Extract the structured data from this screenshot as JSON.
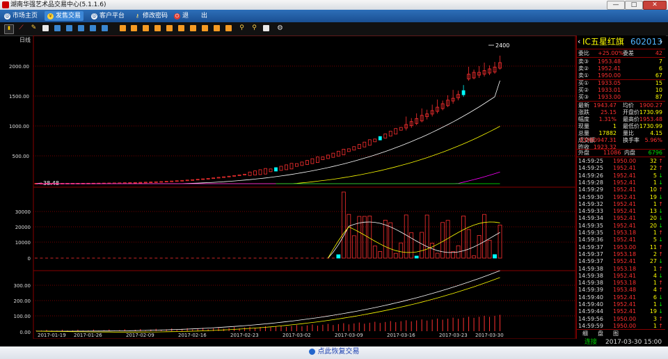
{
  "window": {
    "title": "湖南华强艺术品交易中心(5.1.1.6)",
    "minimize": "—",
    "maximize": "□",
    "close": "✕"
  },
  "menu": [
    {
      "label": "市场主页",
      "icon": "globe-icon"
    },
    {
      "label": "发售交易",
      "icon": "yen-icon"
    },
    {
      "label": "客户平台",
      "icon": "globe-icon"
    },
    {
      "label": "修改密码",
      "icon": "key-icon"
    },
    {
      "label": "退　　出",
      "icon": "power-icon"
    }
  ],
  "chart": {
    "period_label": "日线",
    "price_ticks": [
      "2000.00",
      "1500.00",
      "1000.00",
      "500.00"
    ],
    "low_marker": "38.48",
    "high_marker": "2400",
    "volume_ticks": [
      "30000",
      "20000",
      "10000",
      "0"
    ],
    "amount_ticks": [
      "300.00",
      "200.00",
      "100.00",
      "0.00"
    ],
    "dates": [
      "2017-01-19",
      "2017-01-26",
      "2017-02-09",
      "2017-02-16",
      "2017-02-23",
      "2017-03-02",
      "2017-03-09",
      "2017-03-16",
      "2017-03-23",
      "2017-03-30"
    ]
  },
  "quote": {
    "name": "IC五星红旗",
    "code": "602013",
    "weibi_label": "委比",
    "weibi_value": "+25.00%",
    "weicha_label": "委差",
    "weicha_value": "42",
    "sell": [
      {
        "label": "卖③",
        "price": "1953.48",
        "vol": "7"
      },
      {
        "label": "卖②",
        "price": "1952.41",
        "vol": "6"
      },
      {
        "label": "卖①",
        "price": "1950.00",
        "vol": "67"
      }
    ],
    "buy": [
      {
        "label": "买①",
        "price": "1933.05",
        "vol": "15"
      },
      {
        "label": "买②",
        "price": "1933.01",
        "vol": "10"
      },
      {
        "label": "买③",
        "price": "1933.00",
        "vol": "87"
      }
    ],
    "stats": [
      {
        "l1": "最新",
        "v1": "1943.47",
        "l2": "均价",
        "v2": "1900.27"
      },
      {
        "l1": "涨跌",
        "v1": "25.15",
        "l2": "开盘价",
        "v2": "1730.99"
      },
      {
        "l1": "幅度",
        "v1": "1.31%",
        "l2": "最高价",
        "v2": "1953.48"
      },
      {
        "l1": "现量",
        "v1": "1",
        "l2": "最低价",
        "v2": "1730.99"
      },
      {
        "l1": "总量",
        "v1": "17882",
        "l2": "量比",
        "v2": "4.15"
      },
      {
        "l1": "成交额",
        "v1": "33980947.31",
        "l2": "换手率",
        "v2": "5.96%"
      },
      {
        "l1": "昨收",
        "v1": "1923.32",
        "l2": "",
        "v2": ""
      }
    ],
    "outer_label": "外盘",
    "outer_value": "11086",
    "inner_label": "内盘",
    "inner_value": "6796",
    "trades": [
      {
        "t": "14:59:25",
        "p": "1950.00",
        "v": "32",
        "d": "up"
      },
      {
        "t": "14:59:25",
        "p": "1952.41",
        "v": "22",
        "d": "up"
      },
      {
        "t": "14:59:26",
        "p": "1952.41",
        "v": "5",
        "d": "down"
      },
      {
        "t": "14:59:28",
        "p": "1952.41",
        "v": "1",
        "d": "down"
      },
      {
        "t": "14:59:29",
        "p": "1952.41",
        "v": "10",
        "d": "up"
      },
      {
        "t": "14:59:30",
        "p": "1952.41",
        "v": "19",
        "d": "down"
      },
      {
        "t": "14:59:32",
        "p": "1952.41",
        "v": "1",
        "d": "up"
      },
      {
        "t": "14:59:33",
        "p": "1952.41",
        "v": "13",
        "d": "down"
      },
      {
        "t": "14:59:34",
        "p": "1952.41",
        "v": "20",
        "d": "down"
      },
      {
        "t": "14:59:35",
        "p": "1952.41",
        "v": "20",
        "d": "down"
      },
      {
        "t": "14:59:35",
        "p": "1953.18",
        "v": "1",
        "d": "up"
      },
      {
        "t": "14:59:36",
        "p": "1952.41",
        "v": "5",
        "d": "down"
      },
      {
        "t": "14:59:37",
        "p": "1953.00",
        "v": "11",
        "d": "up"
      },
      {
        "t": "14:59:37",
        "p": "1953.18",
        "v": "2",
        "d": "up"
      },
      {
        "t": "14:59:37",
        "p": "1952.41",
        "v": "27",
        "d": "down"
      },
      {
        "t": "14:59:38",
        "p": "1953.18",
        "v": "1",
        "d": "up"
      },
      {
        "t": "14:59:38",
        "p": "1952.41",
        "v": "4",
        "d": "down"
      },
      {
        "t": "14:59:38",
        "p": "1953.18",
        "v": "1",
        "d": "up"
      },
      {
        "t": "14:59:39",
        "p": "1953.48",
        "v": "4",
        "d": "up"
      },
      {
        "t": "14:59:40",
        "p": "1952.41",
        "v": "6",
        "d": "down"
      },
      {
        "t": "14:59:40",
        "p": "1952.41",
        "v": "1",
        "d": "down"
      },
      {
        "t": "14:59:44",
        "p": "1952.41",
        "v": "19",
        "d": "down"
      },
      {
        "t": "14:59:56",
        "p": "1950.00",
        "v": "3",
        "d": "up"
      },
      {
        "t": "14:59:59",
        "p": "1950.00",
        "v": "1",
        "d": "up"
      }
    ],
    "tabs": [
      "细",
      "盘",
      "图"
    ]
  },
  "status": {
    "conn": "连接",
    "datetime": "2017-03-30  15:00"
  },
  "footer": {
    "restore": "点此恢复交易"
  },
  "colors": {
    "up": "#ff3030",
    "down": "#00ffff",
    "ma1": "#ffffff",
    "ma2": "#ffff00",
    "ma3": "#ff00ff",
    "ma4": "#00ff00"
  }
}
